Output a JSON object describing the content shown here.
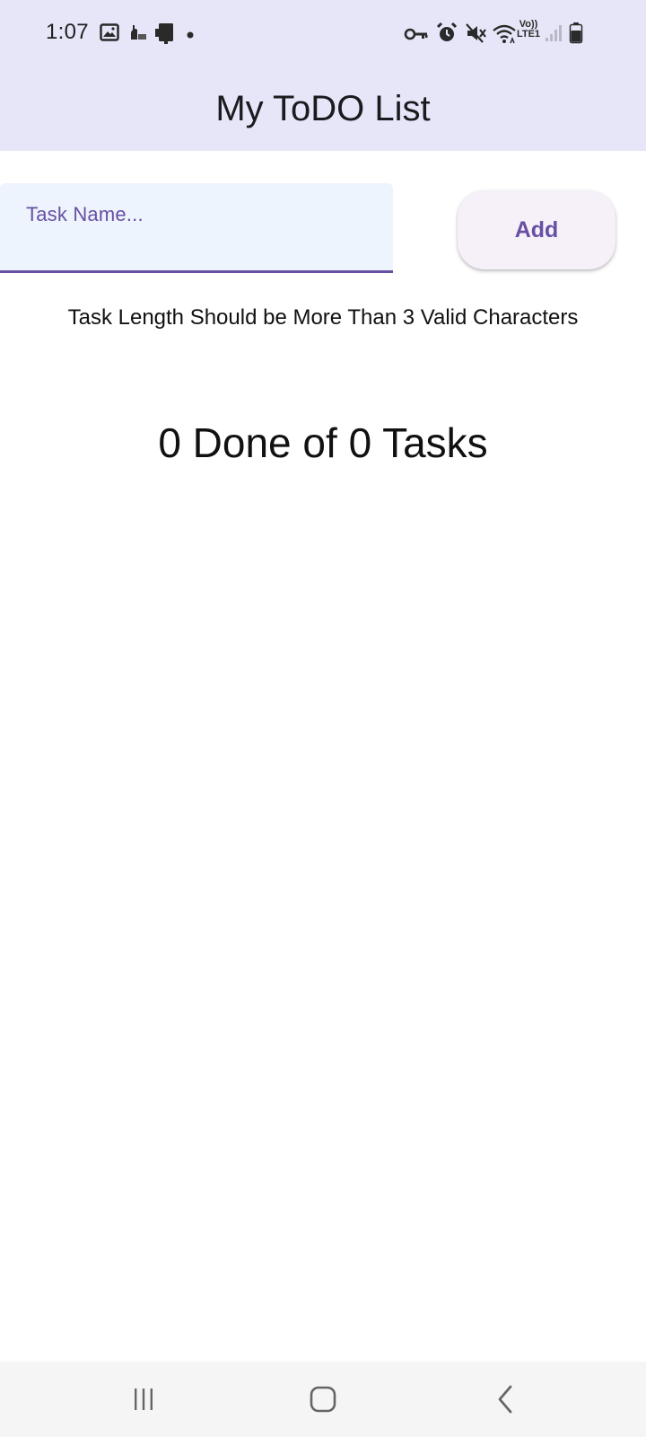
{
  "status_bar": {
    "time": "1:07",
    "left_icons": [
      "gallery-icon",
      "notification-icon",
      "cast-icon",
      "dot-icon"
    ],
    "right_icons": [
      "vpn-key-icon",
      "alarm-icon",
      "mute-icon",
      "wifi-icon",
      "volte-icon",
      "signal-icon",
      "battery-icon"
    ],
    "network_label_top": "Vo))",
    "network_label_bottom": "LTE1"
  },
  "app_bar": {
    "title": "My ToDO List",
    "background": "#e6e6f8"
  },
  "task_input": {
    "label": "Task Name...",
    "value": "",
    "accent_color": "#6750a4"
  },
  "add_button": {
    "label": "Add"
  },
  "validation": {
    "hint": "Task Length Should be More Than 3 Valid Characters"
  },
  "summary": {
    "text": "0 Done of 0 Tasks",
    "done": 0,
    "total": 0
  },
  "nav_bar": {
    "buttons": [
      "recents-icon",
      "home-icon",
      "back-icon"
    ]
  }
}
